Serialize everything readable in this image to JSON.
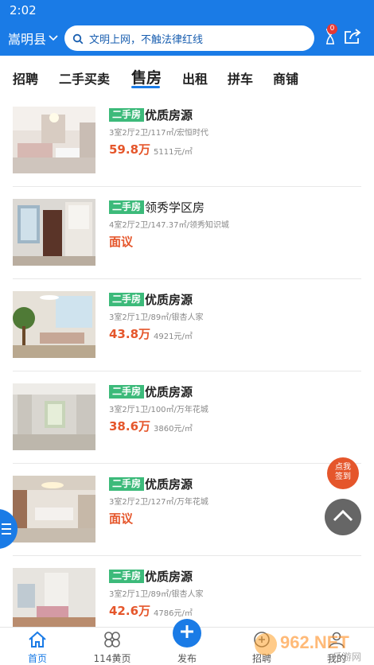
{
  "status": {
    "time": "2:02"
  },
  "header": {
    "city": "嵩明县",
    "search_placeholder": "文明上网，不触法律红线",
    "notification_count": "0",
    "colors": {
      "primary": "#1a7be6",
      "price": "#e5562b",
      "tag": "#3cba7a"
    }
  },
  "tabs": [
    {
      "label": "招聘"
    },
    {
      "label": "二手买卖"
    },
    {
      "label": "售房",
      "active": true
    },
    {
      "label": "出租"
    },
    {
      "label": "拼车"
    },
    {
      "label": "商铺"
    }
  ],
  "listings": [
    {
      "tag": "二手房",
      "title": "优质房源",
      "desc": "3室2厅2卫/117㎡/宏恒时代",
      "price": "59.8万",
      "unit_price": "5111元/㎡"
    },
    {
      "tag": "二手房",
      "title": "领秀学区房",
      "desc": "4室2厅2卫/147.37㎡/领秀知识城",
      "price": "面议",
      "unit_price": ""
    },
    {
      "tag": "二手房",
      "title": "优质房源",
      "desc": "3室2厅1卫/89㎡/银杏人家",
      "price": "43.8万",
      "unit_price": "4921元/㎡"
    },
    {
      "tag": "二手房",
      "title": "优质房源",
      "desc": "3室2厅1卫/100㎡/万年花城",
      "price": "38.6万",
      "unit_price": "3860元/㎡"
    },
    {
      "tag": "二手房",
      "title": "优质房源",
      "desc": "3室2厅2卫/127㎡/万年花城",
      "price": "面议",
      "unit_price": ""
    },
    {
      "tag": "二手房",
      "title": "优质房源",
      "desc": "3室2厅1卫/89㎡/银杏人家",
      "price": "42.6万",
      "unit_price": "4786元/㎡"
    }
  ],
  "floating": {
    "signin": "点我签到"
  },
  "bottom_nav": [
    {
      "label": "首页",
      "icon": "home-icon",
      "active": true
    },
    {
      "label": "114黄页",
      "icon": "clover-icon"
    },
    {
      "label": "发布",
      "icon": "plus-icon"
    },
    {
      "label": "招聘",
      "icon": "recruit-icon"
    },
    {
      "label": "我的",
      "icon": "user-icon"
    }
  ],
  "watermark": {
    "text": "962.NET",
    "sub": "乐游网"
  }
}
